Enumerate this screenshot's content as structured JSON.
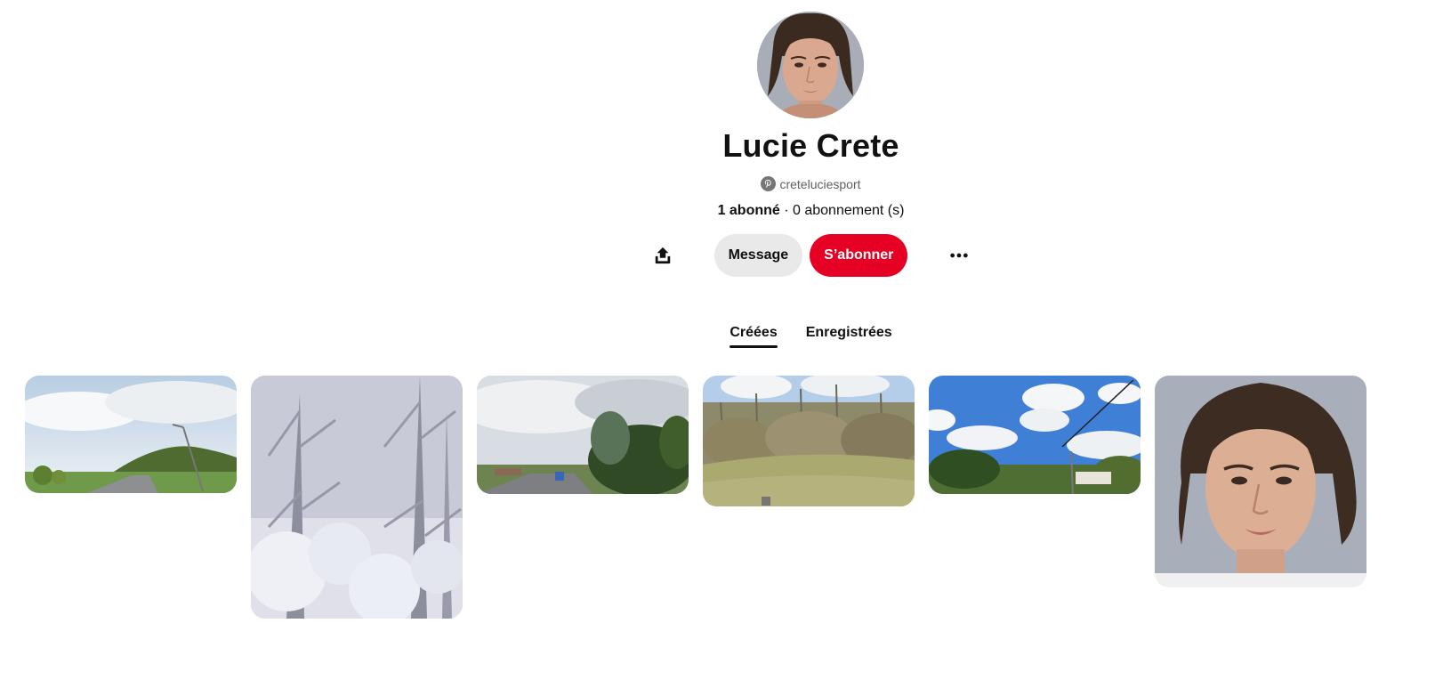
{
  "profile": {
    "name": "Lucie Crete",
    "username": "creteluciesport",
    "followers_count": "1 abonné",
    "separator": " · ",
    "following_text": "0 abonnement (s)"
  },
  "actions": {
    "message_label": "Message",
    "follow_label": "S’abonner"
  },
  "tabs": [
    {
      "label": "Créées",
      "active": true
    },
    {
      "label": "Enregistrées",
      "active": false
    }
  ],
  "pins": [
    {
      "subject": "road with hill under cloudy sky"
    },
    {
      "subject": "snow covered trees"
    },
    {
      "subject": "street with trees and cloudy sky"
    },
    {
      "subject": "shrubs on grassy slope"
    },
    {
      "subject": "blue sky with clouds over village"
    },
    {
      "subject": "portrait of a woman"
    }
  ],
  "colors": {
    "accent": "#e60023",
    "secondary_button": "#e9e9e9",
    "text": "#111111",
    "muted": "#5f5f5f"
  },
  "icons": [
    "share-icon",
    "pinterest-icon",
    "more-icon"
  ]
}
